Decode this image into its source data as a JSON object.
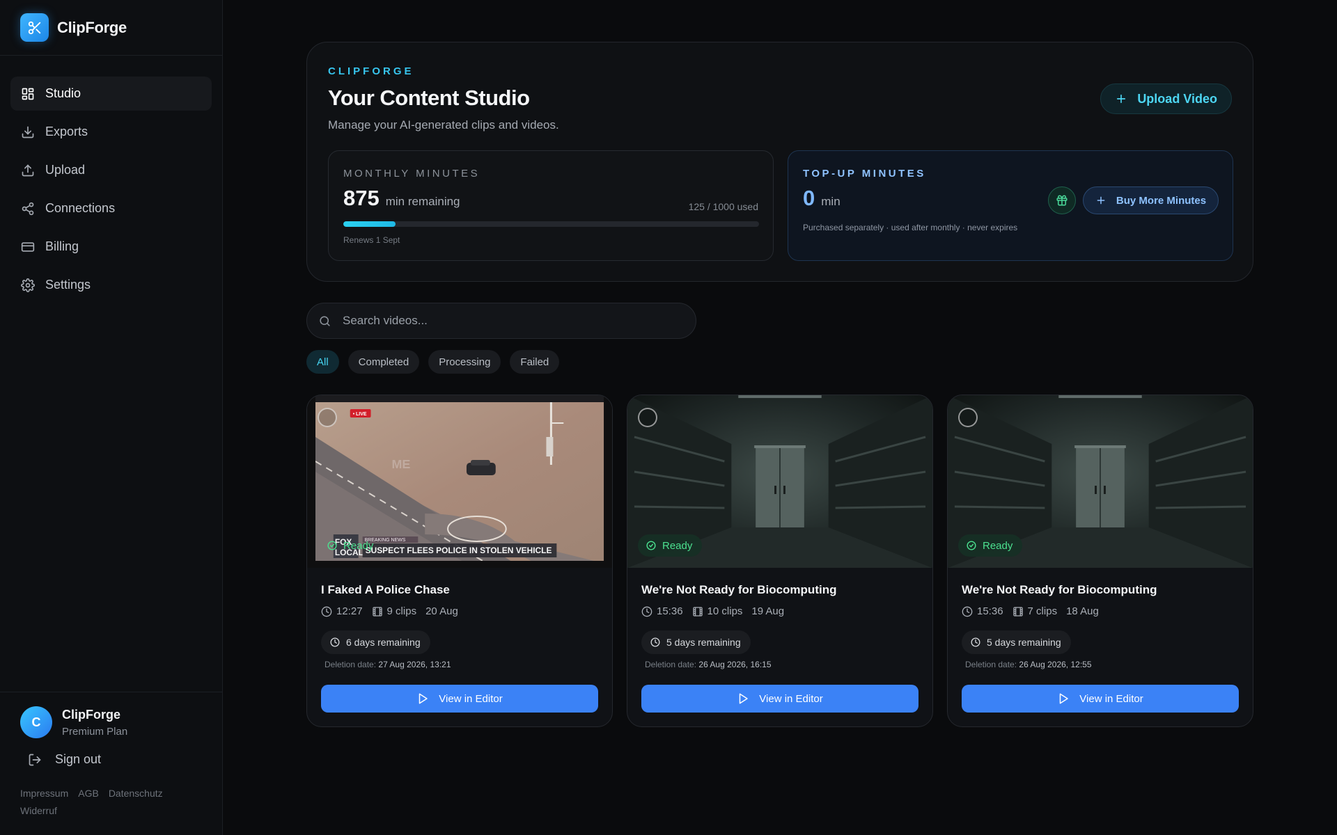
{
  "brand": {
    "name": "ClipForge"
  },
  "sidebar": {
    "items": [
      {
        "label": "Studio",
        "icon": "grid-icon",
        "active": true
      },
      {
        "label": "Exports",
        "icon": "download-icon"
      },
      {
        "label": "Upload",
        "icon": "upload-icon"
      },
      {
        "label": "Connections",
        "icon": "share-icon"
      },
      {
        "label": "Billing",
        "icon": "credit-card-icon"
      },
      {
        "label": "Settings",
        "icon": "gear-icon"
      }
    ]
  },
  "user": {
    "initial": "C",
    "name": "ClipForge",
    "plan": "Premium Plan"
  },
  "signout": {
    "label": "Sign out"
  },
  "footer": {
    "links": [
      "Impressum",
      "AGB",
      "Datenschutz",
      "Widerruf"
    ]
  },
  "hero": {
    "eyebrow": "CLIPFORGE",
    "title": "Your Content Studio",
    "subtitle": "Manage your AI-generated clips and videos.",
    "upload_label": "Upload Video"
  },
  "monthly": {
    "label": "MONTHLY MINUTES",
    "value": "875",
    "unit": "min remaining",
    "used": "125 / 1000 used",
    "used_fraction": 0.125,
    "renews": "Renews 1 Sept"
  },
  "topup": {
    "label": "TOP-UP MINUTES",
    "value": "0",
    "unit": "min",
    "note": "Purchased separately · used after monthly · never expires",
    "buy_label": "Buy More Minutes"
  },
  "search": {
    "placeholder": "Search videos..."
  },
  "filters": [
    {
      "label": "All",
      "active": true
    },
    {
      "label": "Completed"
    },
    {
      "label": "Processing"
    },
    {
      "label": "Failed"
    }
  ],
  "videos": [
    {
      "status": "Ready",
      "title": "I Faked A Police Chase",
      "duration": "12:27",
      "clips": "9 clips",
      "date": "20 Aug",
      "remaining": "6 days remaining",
      "deletion_label": "Deletion date:",
      "deletion_date": "27 Aug 2026, 13:21",
      "button": "View in Editor",
      "thumb_text": {
        "live": "• LIVE",
        "ticker": "SUSPECT FLEES POLICE IN STOLEN VEHICLE",
        "breaking": "BREAKING NEWS",
        "logo_top": "FOX",
        "logo_bottom": "LOCAL"
      }
    },
    {
      "status": "Ready",
      "title": "We're Not Ready for Biocomputing",
      "duration": "15:36",
      "clips": "10 clips",
      "date": "19 Aug",
      "remaining": "5 days remaining",
      "deletion_label": "Deletion date:",
      "deletion_date": "26 Aug 2026, 16:15",
      "button": "View in Editor"
    },
    {
      "status": "Ready",
      "title": "We're Not Ready for Biocomputing",
      "duration": "15:36",
      "clips": "7 clips",
      "date": "18 Aug",
      "remaining": "5 days remaining",
      "deletion_label": "Deletion date:",
      "deletion_date": "26 Aug 2026, 12:55",
      "button": "View in Editor"
    }
  ]
}
